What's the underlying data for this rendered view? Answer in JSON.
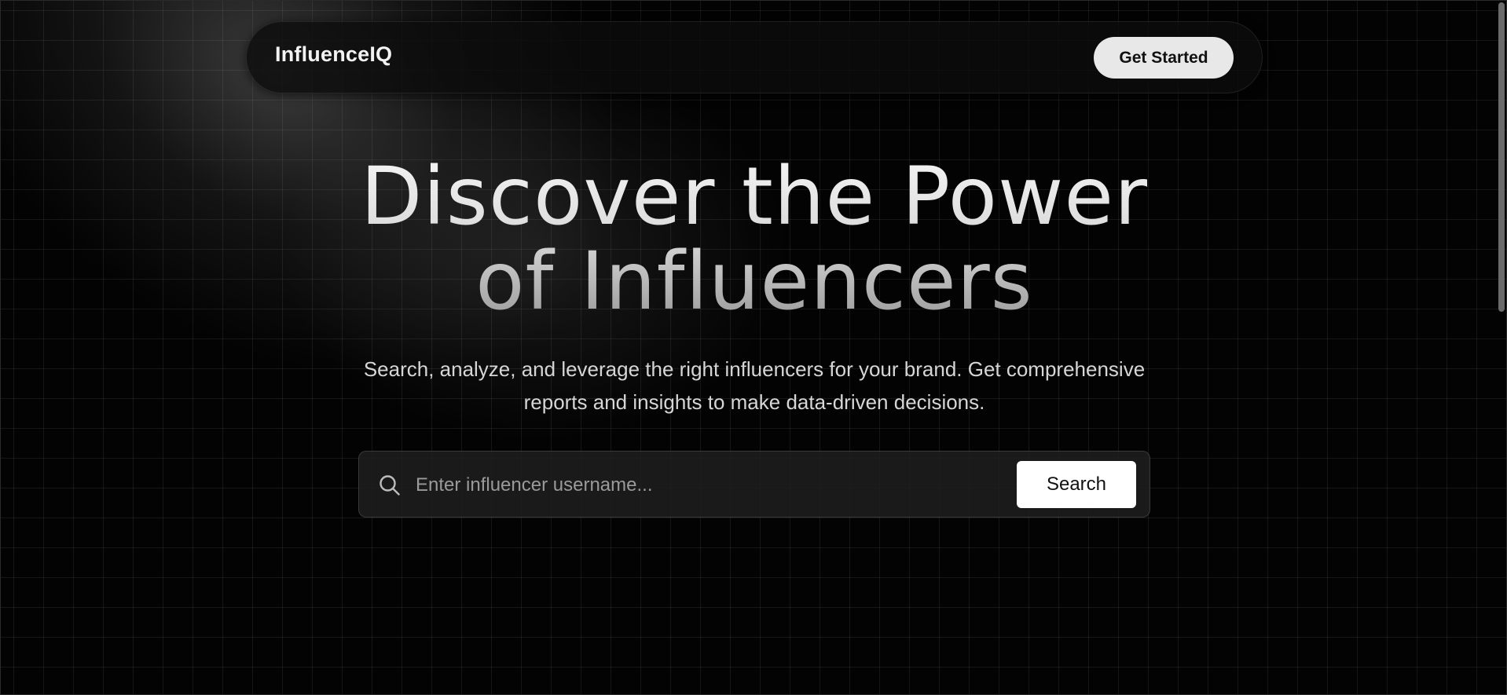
{
  "navbar": {
    "brand": "InfluenceIQ",
    "cta_label": "Get Started"
  },
  "hero": {
    "title_line1": "Discover the Power",
    "title_line2": "of Influencers",
    "subtitle": "Search, analyze, and leverage the right influencers for your brand. Get comprehensive reports and insights to make data-driven decisions."
  },
  "search": {
    "placeholder": "Enter influencer username...",
    "value": "",
    "button_label": "Search",
    "icon": "search-icon"
  },
  "colors": {
    "background": "#030303",
    "text": "#f2f2f2",
    "button_bg": "#ffffff"
  }
}
